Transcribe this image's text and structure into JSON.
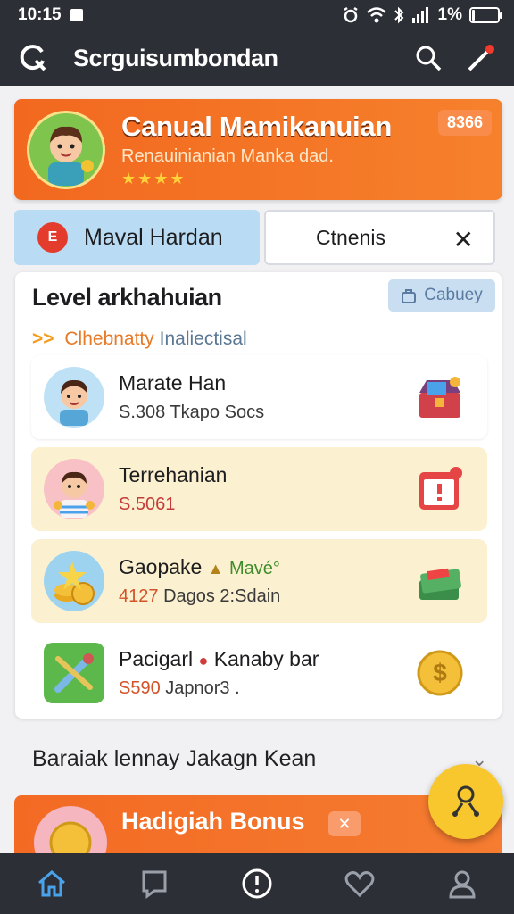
{
  "status_bar": {
    "time": "10:15",
    "battery": "1%",
    "battery_level": 0.1
  },
  "app_bar": {
    "title": "Scrguisumbondan"
  },
  "hero": {
    "title": "Canual Mamikanuian",
    "subtitle": "Renauinianian Manka dad.",
    "stars": "★★★★",
    "badge": "8366"
  },
  "tabs": {
    "left_label": "Maval Hardan",
    "left_icon_text": "E",
    "right_label": "Ctnenis",
    "close_glyph": "✕"
  },
  "level_card": {
    "title": "Level arkhahuian",
    "chip_label": "Cabuey",
    "subtitle_arrow": ">>",
    "subtitle_main": "Clhebnatty",
    "subtitle_muted": "Inaliectisal",
    "rows": [
      {
        "name": "Marate Han",
        "sub_value": "S.308",
        "sub_text": "Tkapo Socs",
        "bg": "#ffffff"
      },
      {
        "name": "Terrehanian",
        "sub_value": "S.5061",
        "sub_text": "",
        "bg": "#fbf0cf"
      },
      {
        "name": "Gaopake",
        "name_extra": "Mavé°",
        "sub_value": "4127",
        "sub_text": "Dagos 2:Sdain",
        "bg": "#fbf0cf"
      },
      {
        "name": "Pacigarl",
        "name_extra": "Kanaby bar",
        "sub_value": "S590",
        "sub_text": "Japnor3 .",
        "bg": "#ffffff"
      }
    ]
  },
  "footer": {
    "text": "Baraiak lennay Jakagn Kean",
    "chevron": "⌄"
  },
  "bonus": {
    "title": "Hadigiah Bonus",
    "close_glyph": "✕"
  },
  "colors": {
    "orange": "#f2681f",
    "dark_bar": "#2c2f36",
    "blue_tab": "#b9dcf4",
    "nav_active": "#4aa3ea"
  }
}
